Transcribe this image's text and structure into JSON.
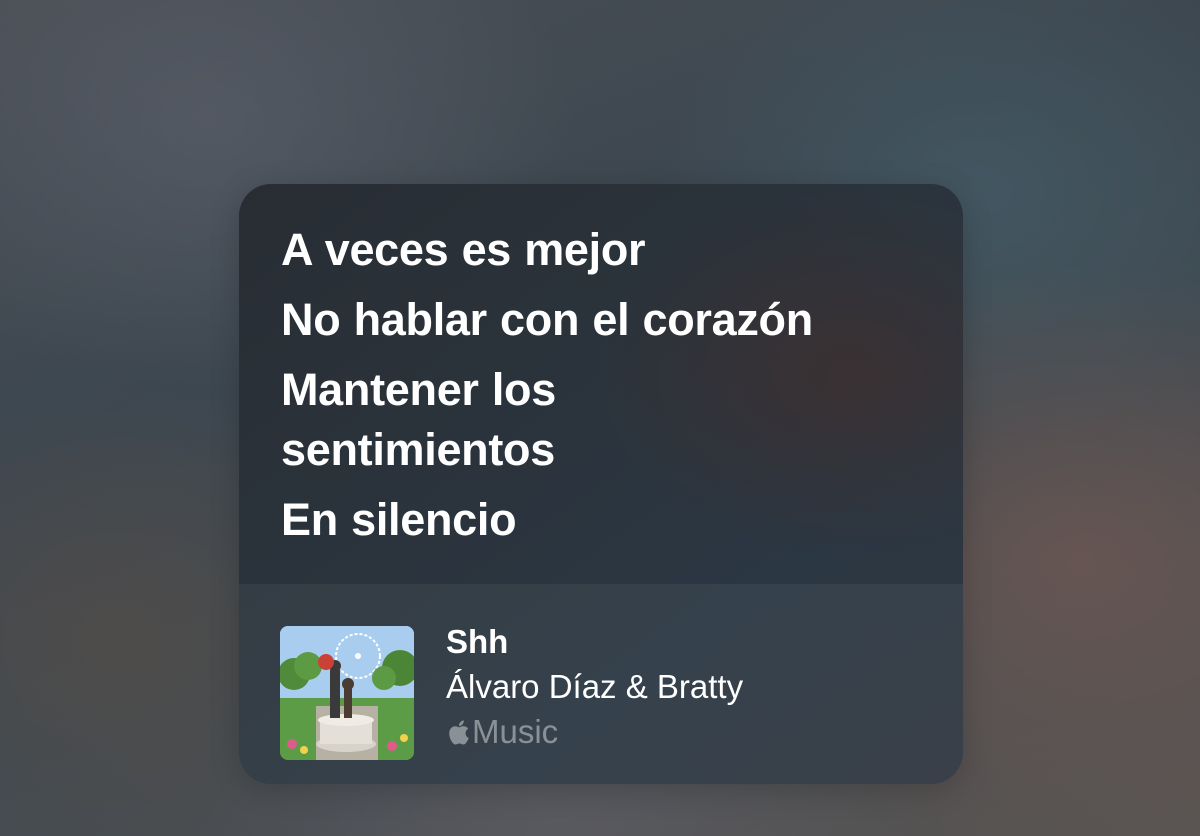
{
  "lyrics": {
    "lines": [
      "A veces es mejor",
      "No hablar con el corazón",
      "Mantener los sentimientos",
      "En silencio"
    ]
  },
  "track": {
    "title": "Shh",
    "artist": "Álvaro Díaz & Bratty",
    "source_label": "Music",
    "source_icon": "apple-logo-icon"
  }
}
